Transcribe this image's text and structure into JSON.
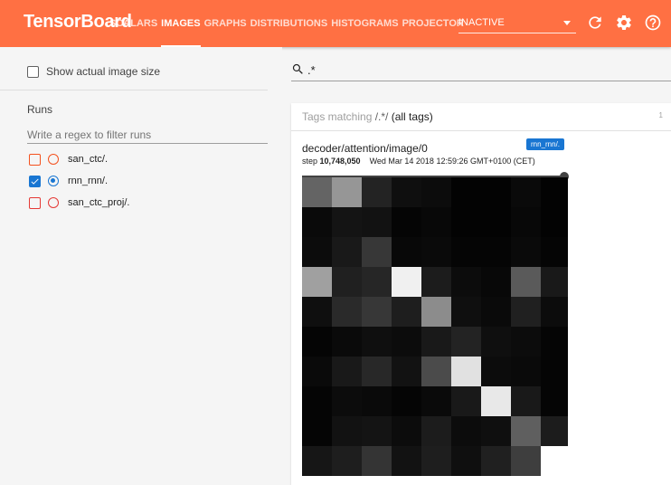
{
  "header": {
    "brand": "TensorBoard",
    "tabs": [
      {
        "label": "SCALARS",
        "active": false
      },
      {
        "label": "IMAGES",
        "active": true
      },
      {
        "label": "GRAPHS",
        "active": false
      },
      {
        "label": "DISTRIBUTIONS",
        "active": false
      },
      {
        "label": "HISTOGRAMS",
        "active": false
      },
      {
        "label": "PROJECTOR",
        "active": false
      }
    ],
    "inactive_label": "INACTIVE",
    "icons": [
      "refresh-icon",
      "settings-icon",
      "help-icon"
    ]
  },
  "sidebar": {
    "show_actual_size_label": "Show actual image size",
    "show_actual_size_checked": false,
    "runs_title": "Runs",
    "filter_placeholder": "Write a regex to filter runs",
    "runs": [
      {
        "name": "san_ctc/.",
        "checked": false,
        "selected": false,
        "color": "#f4511e"
      },
      {
        "name": "rnn_rnn/.",
        "checked": true,
        "selected": true,
        "color": "#1976d2"
      },
      {
        "name": "san_ctc_proj/.",
        "checked": false,
        "selected": false,
        "color": "#e53935"
      }
    ]
  },
  "main": {
    "search_value": ".*",
    "tags_prefix": "Tags matching ",
    "tags_pattern": "/.*/",
    "tags_suffix": " (all tags)",
    "tag_count": "1",
    "image_card": {
      "title": "decoder/attention/image/0",
      "run_badge": "rnn_rnn/.",
      "step_prefix": "step ",
      "step_value": "10,748,050",
      "date": "Wed Mar 14 2018 12:59:26 GMT+0100 (CET)",
      "slider_fraction": 1.0
    }
  },
  "heatmap_data": {
    "cells_intensity_0_255": [
      [
        100,
        150,
        35,
        15,
        12,
        3,
        3,
        10,
        3
      ],
      [
        10,
        20,
        18,
        5,
        8,
        3,
        3,
        8,
        3
      ],
      [
        12,
        25,
        55,
        8,
        10,
        5,
        5,
        10,
        5
      ],
      [
        160,
        32,
        38,
        240,
        28,
        12,
        8,
        90,
        25
      ],
      [
        15,
        42,
        55,
        30,
        140,
        15,
        10,
        32,
        12
      ],
      [
        5,
        10,
        15,
        12,
        25,
        35,
        15,
        12,
        5
      ],
      [
        10,
        25,
        40,
        18,
        75,
        225,
        12,
        10,
        5
      ],
      [
        5,
        12,
        10,
        5,
        10,
        25,
        232,
        25,
        5
      ],
      [
        5,
        18,
        20,
        12,
        28,
        12,
        15,
        95,
        28
      ],
      [
        22,
        30,
        52,
        18,
        30,
        15,
        32,
        62,
        null
      ]
    ],
    "colors": {
      "brand": "#ff7043",
      "badge": "#1976d2"
    }
  }
}
